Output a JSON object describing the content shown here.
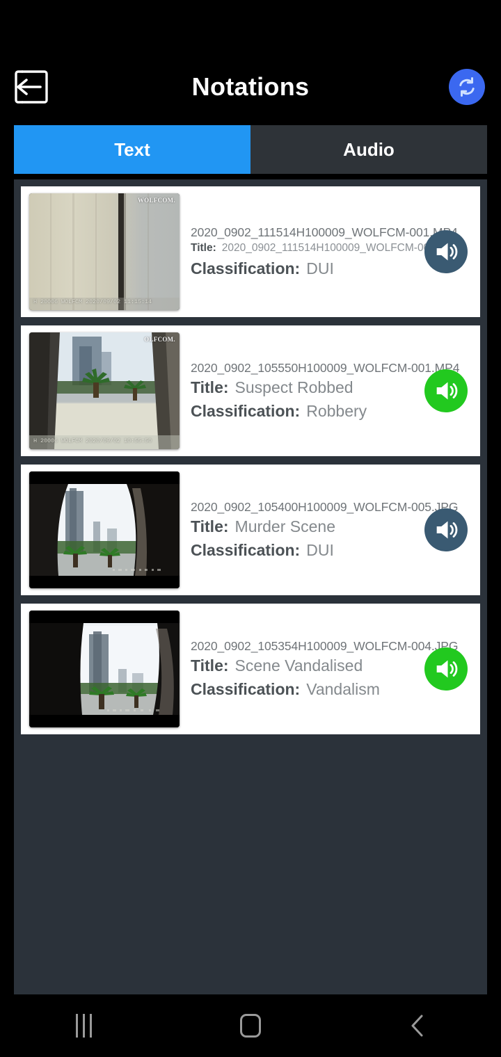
{
  "header": {
    "title": "Notations",
    "back_icon": "back-arrow-box-icon",
    "refresh_icon": "sync-refresh-icon",
    "refresh_color": "#3b68f0"
  },
  "tabs": [
    {
      "label": "Text",
      "active": true,
      "color": "#2196f3"
    },
    {
      "label": "Audio",
      "active": false,
      "color": "#2e3338"
    }
  ],
  "labels": {
    "title": "Title:",
    "classification": "Classification:"
  },
  "items": [
    {
      "filename": "2020_0902_111514H100009_WOLFCM-001.MP4",
      "title": "2020_0902_111514H100009_WOLFCM-001.MP4",
      "title_small": true,
      "classification": "DUI",
      "speaker_icon": "speaker-volume-icon",
      "speaker_color": "#3a5a72",
      "thumbnail": {
        "scene": "beige-wall-with-dark-stripe",
        "watermark": "WOLFCOM.",
        "timestamp": "H 20006 WOLFCM  2020/09/02  11:15:14"
      }
    },
    {
      "filename": "2020_0902_105550H100009_WOLFCM-001.MP4",
      "title": "Suspect Robbed",
      "title_small": false,
      "classification": "Robbery",
      "speaker_icon": "speaker-volume-icon",
      "speaker_color": "#22c91f",
      "thumbnail": {
        "scene": "courtyard-palm-trees-pillars",
        "watermark": "OLFCOM.",
        "timestamp": "H 20006 WOLFCM  2020/09/02  10:55:50"
      }
    },
    {
      "filename": "2020_0902_105400H100009_WOLFCM-005.JPG",
      "title": "Murder Scene",
      "title_small": false,
      "classification": "DUI",
      "speaker_icon": "speaker-volume-icon",
      "speaker_color": "#3a5a72",
      "thumbnail": {
        "scene": "letterboxed-city-view-palms",
        "watermark": "",
        "timestamp": ""
      }
    },
    {
      "filename": "2020_0902_105354H100009_WOLFCM-004.JPG",
      "title": "Scene Vandalised",
      "title_small": false,
      "classification": "Vandalism",
      "speaker_icon": "speaker-volume-icon",
      "speaker_color": "#22c91f",
      "thumbnail": {
        "scene": "letterboxed-tower-palms",
        "watermark": "",
        "timestamp": ""
      }
    }
  ],
  "navbar": {
    "recents_icon": "recents-bars-icon",
    "home_icon": "home-square-icon",
    "back_icon": "back-chevron-icon"
  }
}
